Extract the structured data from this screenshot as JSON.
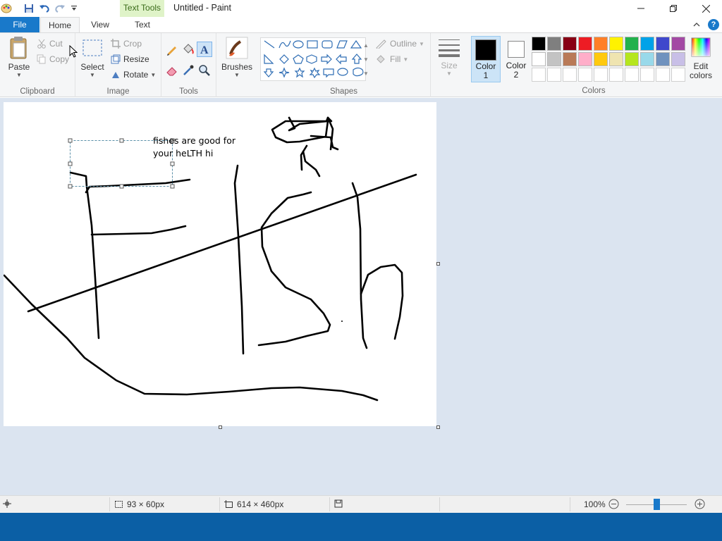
{
  "window": {
    "title": "Untitled - Paint",
    "contextual_tab": "Text Tools"
  },
  "tabs": {
    "file": "File",
    "home": "Home",
    "view": "View",
    "text": "Text",
    "help": "?"
  },
  "ribbon": {
    "clipboard": {
      "label": "Clipboard",
      "paste": "Paste",
      "cut": "Cut",
      "copy": "Copy"
    },
    "image": {
      "label": "Image",
      "select": "Select",
      "crop": "Crop",
      "resize": "Resize",
      "rotate": "Rotate"
    },
    "tools": {
      "label": "Tools"
    },
    "brushes": {
      "label": "Brushes"
    },
    "shapes": {
      "label": "Shapes",
      "outline": "Outline",
      "fill": "Fill"
    },
    "size": {
      "label": "Size"
    },
    "color1": {
      "label_line1": "Color",
      "label_line2": "1",
      "value": "#000000"
    },
    "color2": {
      "label_line1": "Color",
      "label_line2": "2",
      "value": "#ffffff"
    },
    "colors": {
      "label": "Colors",
      "edit_line1": "Edit",
      "edit_line2": "colors",
      "row1": [
        "#000000",
        "#7f7f7f",
        "#880015",
        "#ed1c24",
        "#ff7f27",
        "#fff200",
        "#22b14c",
        "#00a2e8",
        "#3f48cc",
        "#a349a4"
      ],
      "row2": [
        "#ffffff",
        "#c3c3c3",
        "#b97a57",
        "#ffaec9",
        "#ffc90e",
        "#efe4b0",
        "#b5e61d",
        "#99d9ea",
        "#7092be",
        "#c8bfe7"
      ]
    }
  },
  "canvas": {
    "text_line1": "fishes are good for",
    "text_line2": "your heLTH hi"
  },
  "status": {
    "selection_size": "93 × 60px",
    "canvas_size": "614 × 460px",
    "zoom": "100%",
    "zoom_level": 1.0
  }
}
